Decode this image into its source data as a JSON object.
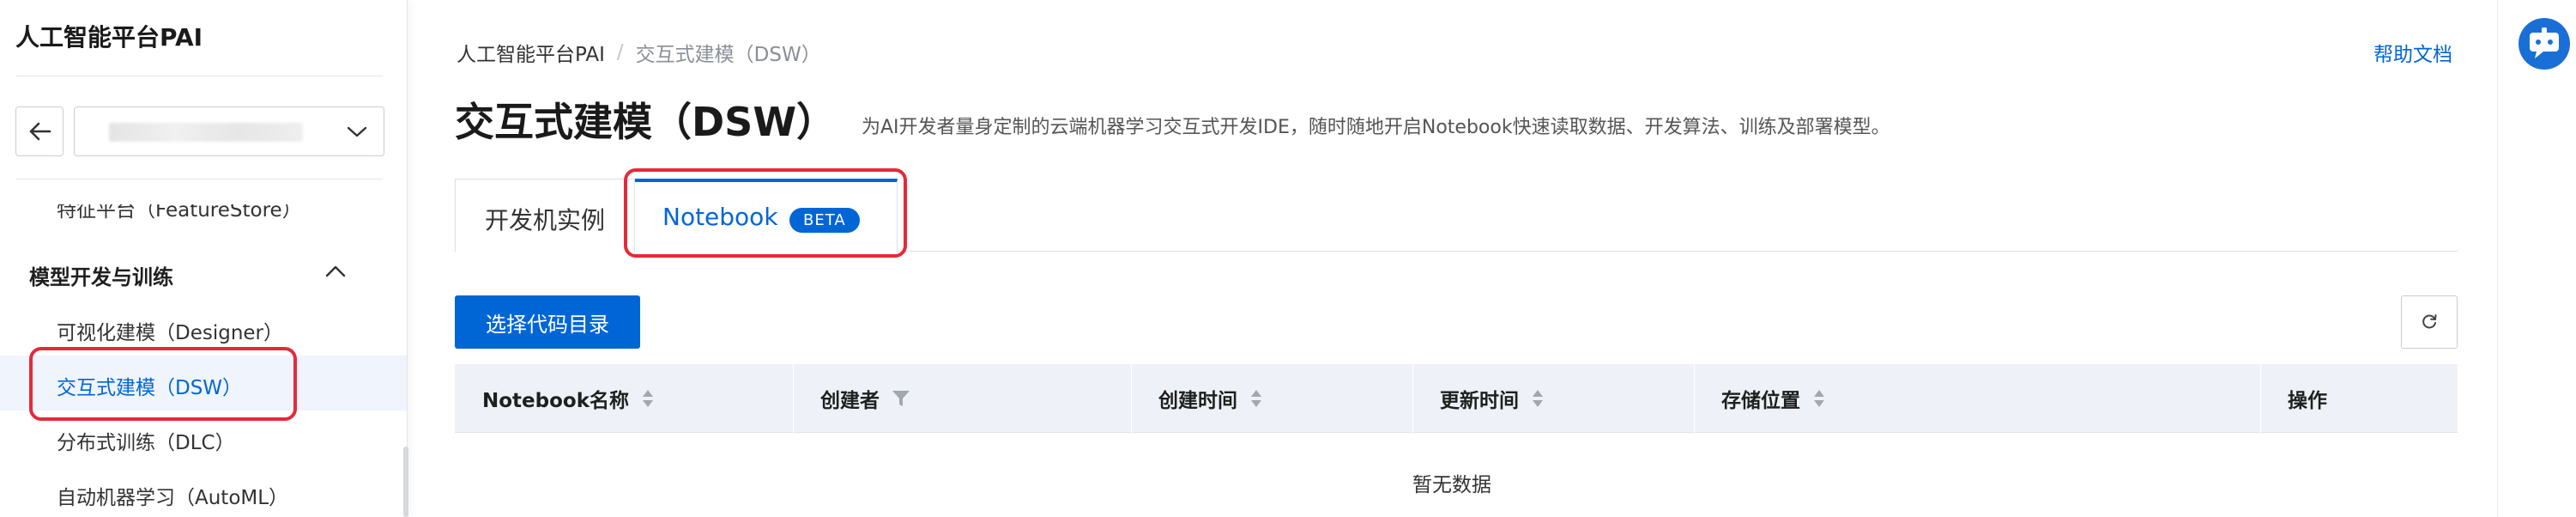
{
  "sidebar": {
    "title": "人工智能平台PAI",
    "items": [
      {
        "label": "特征平台（FeatureStore）"
      },
      {
        "label": "可视化建模（Designer）"
      },
      {
        "label": "交互式建模（DSW）"
      },
      {
        "label": "分布式训练（DLC）"
      },
      {
        "label": "自动机器学习（AutoML）"
      }
    ],
    "group": {
      "label": "模型开发与训练",
      "expanded": true
    },
    "active_color": "#0066d6"
  },
  "header": {
    "breadcrumb": {
      "root": "人工智能平台PAI",
      "separator": "/",
      "current": "交互式建模（DSW）"
    },
    "help_link": "帮助文档",
    "title": "交互式建模（DSW）",
    "description": "为AI开发者量身定制的云端机器学习交互式开发IDE，随时随地开启Notebook快速读取数据、开发算法、训练及部署模型。"
  },
  "tabs": [
    {
      "label": "开发机实例",
      "active": false
    },
    {
      "label": "Notebook",
      "badge": "BETA",
      "active": true
    }
  ],
  "toolbar": {
    "primary_button": "选择代码目录",
    "refresh_icon": "refresh-icon"
  },
  "table": {
    "columns": [
      {
        "label": "Notebook名称",
        "icon": "sort"
      },
      {
        "label": "创建者",
        "icon": "filter"
      },
      {
        "label": "创建时间",
        "icon": "sort"
      },
      {
        "label": "更新时间",
        "icon": "sort"
      },
      {
        "label": "存储位置",
        "icon": "sort"
      },
      {
        "label": "操作",
        "icon": ""
      }
    ],
    "empty_text": "暂无数据"
  },
  "colors": {
    "primary": "#0066d6",
    "highlight": "#e5293a",
    "table_header": "#eef2f8"
  }
}
